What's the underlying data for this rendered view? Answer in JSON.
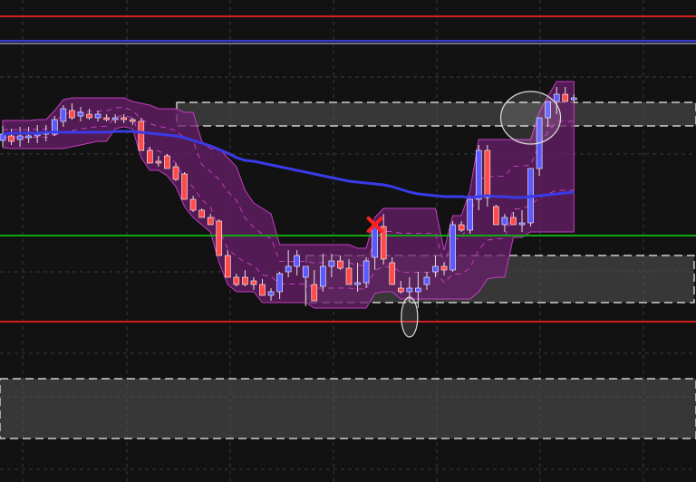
{
  "chart_data": {
    "type": "candlestick",
    "title": "",
    "xlabel": "",
    "ylabel": "",
    "grid": true,
    "legend": "none",
    "ylim": [
      0,
      532
    ],
    "x": [
      1,
      2,
      3,
      4,
      5,
      6,
      7,
      8,
      9,
      10,
      11,
      12,
      13,
      14,
      15,
      16,
      17,
      18,
      19,
      20,
      21,
      22,
      23,
      24,
      25,
      26,
      27,
      28,
      29,
      30,
      31,
      32,
      33,
      34,
      35,
      36,
      37,
      38,
      39,
      40,
      41,
      42,
      43,
      44,
      45,
      46,
      47,
      48,
      49,
      50,
      51,
      52,
      53,
      54,
      55,
      56,
      57,
      58,
      59,
      60,
      61,
      62,
      63,
      64,
      65,
      66,
      67
    ],
    "series": [
      {
        "kind": "ohlc",
        "ohlc": [
          [
            155,
            139,
            162,
            148
          ],
          [
            150,
            142,
            160,
            156
          ],
          [
            154,
            140,
            162,
            150
          ],
          [
            152,
            140,
            158,
            150
          ],
          [
            150,
            138,
            158,
            148
          ],
          [
            148,
            138,
            156,
            146
          ],
          [
            148,
            128,
            150,
            132
          ],
          [
            134,
            116,
            140,
            120
          ],
          [
            122,
            114,
            132,
            130
          ],
          [
            128,
            118,
            134,
            124
          ],
          [
            126,
            120,
            132,
            130
          ],
          [
            130,
            122,
            134,
            126
          ],
          [
            130,
            126,
            134,
            132
          ],
          [
            132,
            126,
            136,
            130
          ],
          [
            130,
            126,
            136,
            132
          ],
          [
            132,
            130,
            138,
            134
          ],
          [
            134,
            130,
            146,
            166
          ],
          [
            166,
            162,
            180,
            180
          ],
          [
            178,
            172,
            184,
            180
          ],
          [
            172,
            170,
            186,
            186
          ],
          [
            184,
            180,
            200,
            198
          ],
          [
            192,
            190,
            206,
            220
          ],
          [
            220,
            216,
            234,
            232
          ],
          [
            232,
            230,
            240,
            240
          ],
          [
            240,
            236,
            246,
            248
          ],
          [
            244,
            242,
            252,
            282
          ],
          [
            282,
            276,
            296,
            306
          ],
          [
            306,
            302,
            316,
            314
          ],
          [
            306,
            298,
            316,
            314
          ],
          [
            310,
            306,
            320,
            314
          ],
          [
            314,
            308,
            322,
            326
          ],
          [
            326,
            318,
            332,
            322
          ],
          [
            322,
            300,
            330,
            302
          ],
          [
            300,
            276,
            306,
            294
          ],
          [
            294,
            276,
            304,
            282
          ],
          [
            306,
            296,
            338,
            294
          ],
          [
            314,
            298,
            322,
            332
          ],
          [
            316,
            280,
            322,
            294
          ],
          [
            294,
            280,
            306,
            288
          ],
          [
            288,
            282,
            298,
            296
          ],
          [
            296,
            286,
            302,
            314
          ],
          [
            314,
            290,
            322,
            312
          ],
          [
            312,
            284,
            318,
            288
          ],
          [
            284,
            246,
            298,
            248
          ],
          [
            250,
            236,
            292,
            286
          ],
          [
            290,
            284,
            298,
            314
          ],
          [
            318,
            310,
            324,
            322
          ],
          [
            322,
            306,
            334,
            318
          ],
          [
            322,
            300,
            340,
            318
          ],
          [
            314,
            300,
            320,
            306
          ],
          [
            300,
            282,
            306,
            294
          ],
          [
            294,
            290,
            304,
            298
          ],
          [
            298,
            244,
            300,
            248
          ],
          [
            248,
            244,
            256,
            254
          ],
          [
            254,
            216,
            258,
            220
          ],
          [
            220,
            160,
            232,
            166
          ],
          [
            166,
            160,
            228,
            218
          ],
          [
            228,
            226,
            238,
            248
          ],
          [
            248,
            236,
            256,
            240
          ],
          [
            240,
            234,
            244,
            248
          ],
          [
            248,
            232,
            256,
            246
          ],
          [
            246,
            186,
            250,
            186
          ],
          [
            186,
            130,
            194,
            130
          ],
          [
            130,
            112,
            140,
            112
          ],
          [
            112,
            96,
            126,
            104
          ],
          [
            104,
            96,
            110,
            112
          ],
          [
            110,
            104,
            114,
            108
          ]
        ]
      },
      {
        "name": "",
        "values": [
          148,
          147,
          147,
          147,
          147,
          146,
          146,
          146,
          146,
          146,
          146,
          146,
          146,
          145,
          145,
          145,
          146,
          147,
          148,
          149,
          150,
          152,
          155,
          158,
          161,
          165,
          169,
          174,
          177,
          178,
          180,
          182,
          184,
          186,
          188,
          190,
          192,
          194,
          196,
          198,
          200,
          201,
          202,
          203,
          204,
          206,
          209,
          212,
          214,
          215,
          216,
          217,
          217,
          217,
          218,
          217,
          216,
          217,
          217,
          218,
          218,
          217,
          216,
          215,
          214,
          213,
          212
        ]
      }
    ],
    "horizontal_lines": [
      {
        "y": 18,
        "color": "#d11f1f"
      },
      {
        "y": 45,
        "color": "#3b3bd8"
      },
      {
        "y": 48,
        "color": "#6f6f90"
      },
      {
        "y": 260,
        "color": "#12a812"
      },
      {
        "y": 355,
        "color": "#d11f1f"
      }
    ],
    "zones": [
      {
        "y1": 113,
        "y2": 139,
        "x_start": 195,
        "x_end": 768
      },
      {
        "y1": 282,
        "y2": 334,
        "x_start": 338,
        "x_end": 766
      },
      {
        "y1": 418,
        "y2": 484,
        "x_start": 0,
        "x_end": 768
      }
    ],
    "colors": {
      "background": "#121212",
      "grid": "#3a3a3a",
      "bull": "#5a5aff",
      "bear": "#ff4a4a",
      "wick": "#e0e0e0",
      "moving_average": "#3a3ae8",
      "channel_fill": "#6a1f6a",
      "channel_stroke": "#c23ec2",
      "zone_fill": "#555555",
      "zone_stroke": "#eeeeee",
      "marker": "#ff2020"
    },
    "annotations": [
      {
        "type": "cross",
        "x_index": 44,
        "y": 248
      },
      {
        "type": "ellipse",
        "x_index": 62,
        "y": 130,
        "rx": 33,
        "ry": 29
      },
      {
        "type": "ellipse",
        "x_index": 48,
        "y": 350,
        "rx": 9,
        "ry": 22
      }
    ]
  }
}
